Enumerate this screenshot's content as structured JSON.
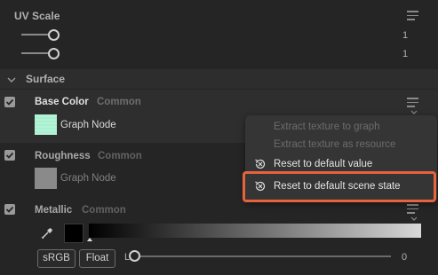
{
  "uv_scale": {
    "label": "UV Scale",
    "slider1_value": "1",
    "slider2_value": "1"
  },
  "surface": {
    "label": "Surface"
  },
  "base_color": {
    "title": "Base Color",
    "subtitle": "Common",
    "source_label": "Graph Node",
    "swatch_color": "#a8f0d0"
  },
  "roughness": {
    "title": "Roughness",
    "subtitle": "Common",
    "source_label": "Graph Node",
    "swatch_color": "#8a8a8a"
  },
  "metallic": {
    "title": "Metallic",
    "subtitle": "Common",
    "srgb_label": "sRGB",
    "float_label": "Float",
    "slider_prefix": "L",
    "slider_value": "0"
  },
  "context_menu": {
    "items": [
      {
        "label": "Extract texture to graph",
        "enabled": false
      },
      {
        "label": "Extract texture as resource",
        "enabled": false
      },
      {
        "label": "Reset to default value",
        "enabled": true
      },
      {
        "label": "Reset to default scene state",
        "enabled": true
      }
    ]
  },
  "colors": {
    "highlight_border": "#e8623c",
    "menu_background": "#353536"
  }
}
